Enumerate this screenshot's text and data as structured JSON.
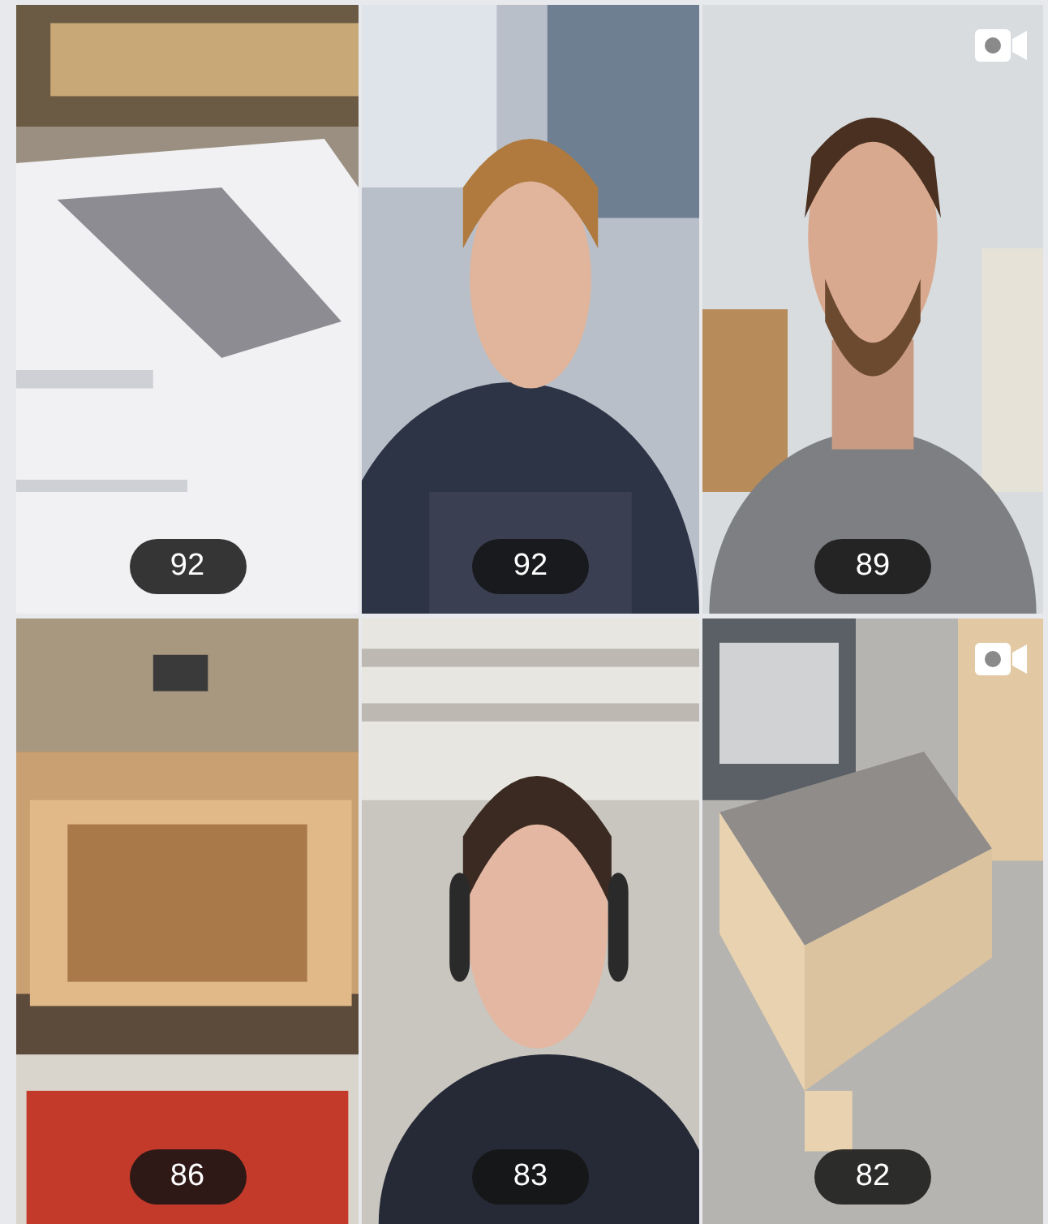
{
  "tiles": [
    {
      "count": "92",
      "video": false
    },
    {
      "count": "92",
      "video": false
    },
    {
      "count": "89",
      "video": true
    },
    {
      "count": "86",
      "video": false
    },
    {
      "count": "83",
      "video": false
    },
    {
      "count": "82",
      "video": true
    }
  ]
}
